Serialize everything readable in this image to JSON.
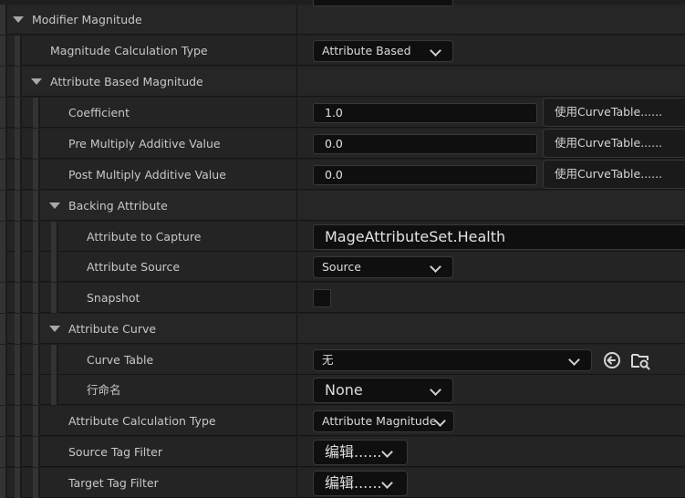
{
  "modifier_magnitude": {
    "label": "Modifier Magnitude"
  },
  "magnitude_calculation_type": {
    "label": "Magnitude Calculation Type",
    "value": "Attribute Based"
  },
  "attribute_based_magnitude": {
    "label": "Attribute Based Magnitude"
  },
  "coefficient": {
    "label": "Coefficient",
    "value": "1.0",
    "curve_button": "使用CurveTable......"
  },
  "pre_multiply": {
    "label": "Pre Multiply Additive Value",
    "value": "0.0",
    "curve_button": "使用CurveTable......"
  },
  "post_multiply": {
    "label": "Post Multiply Additive Value",
    "value": "0.0",
    "curve_button": "使用CurveTable......"
  },
  "backing_attribute": {
    "label": "Backing Attribute",
    "attribute_to_capture": {
      "label": "Attribute to Capture",
      "value": "MageAttributeSet.Health"
    },
    "attribute_source": {
      "label": "Attribute Source",
      "value": "Source"
    },
    "snapshot": {
      "label": "Snapshot",
      "checked": false
    }
  },
  "attribute_curve": {
    "label": "Attribute Curve",
    "curve_table": {
      "label": "Curve Table",
      "value": "无"
    },
    "row_name": {
      "label": "行命名",
      "value": "None"
    }
  },
  "attribute_calculation_type": {
    "label": "Attribute Calculation Type",
    "value": "Attribute Magnitude"
  },
  "source_tag_filter": {
    "label": "Source Tag Filter",
    "value": "编辑......"
  },
  "target_tag_filter": {
    "label": "Target Tag Filter",
    "value": "编辑......"
  }
}
